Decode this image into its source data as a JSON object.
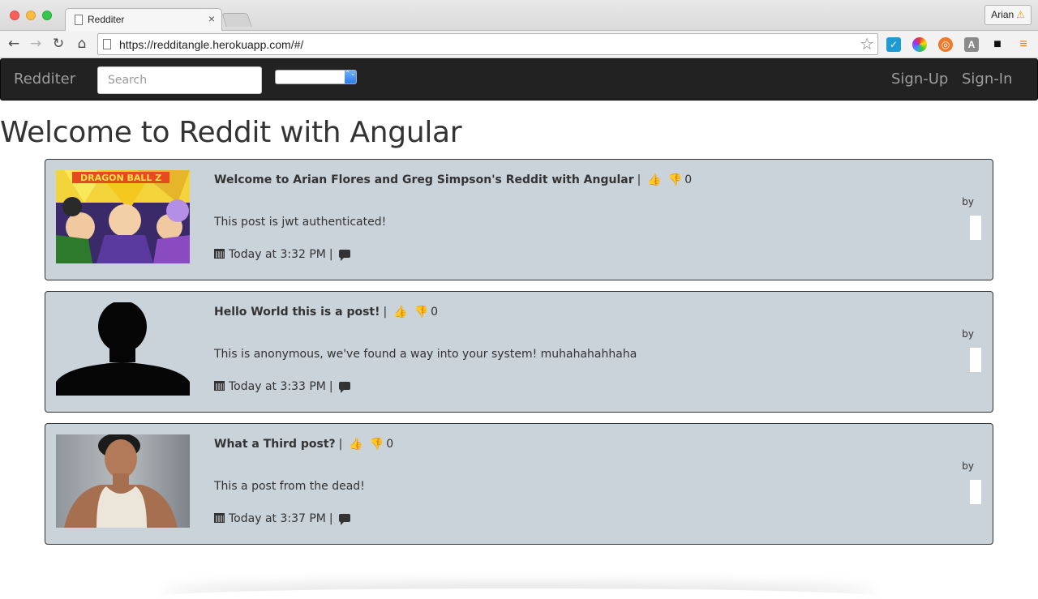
{
  "browser": {
    "tab_title": "Redditer",
    "tab_close": "×",
    "profile_name": "Arian",
    "profile_warning": "⚠",
    "url_prefix": "https://",
    "url_host": "redditangle.herokuapp.com",
    "url_path": "/#/",
    "nav_icons": [
      "back-arrow-icon",
      "forward-arrow-icon",
      "reload-icon",
      "home-icon"
    ],
    "extensions": [
      {
        "name": "checkmark-extension-icon",
        "glyph": "✓"
      },
      {
        "name": "color-wheel-extension-icon",
        "glyph": ""
      },
      {
        "name": "lifebuoy-extension-icon",
        "glyph": "◎"
      },
      {
        "name": "font-extension-icon",
        "glyph": "A"
      },
      {
        "name": "camera-extension-icon",
        "glyph": "■"
      },
      {
        "name": "menu-icon",
        "glyph": "≡"
      }
    ]
  },
  "navbar": {
    "brand": "Redditer",
    "search_placeholder": "Search",
    "select_value": "",
    "signup": "Sign-Up",
    "signin": "Sign-In"
  },
  "page": {
    "title": "Welcome to Reddit with Angular"
  },
  "posts": [
    {
      "title": "Welcome to Arian Flores and Greg Simpson's Reddit with Angular",
      "score": "0",
      "body": "This post is jwt authenticated!",
      "time": "Today at 3:32 PM",
      "by": "by",
      "thumbnail": "dragon-ball-z-image"
    },
    {
      "title": "Hello World this is a post!",
      "score": "0",
      "body": "This is anonymous, we've found a way into your system! muhahahahhaha",
      "time": "Today at 3:33 PM",
      "by": "by",
      "thumbnail": "silhouette-image"
    },
    {
      "title": "What a Third post?",
      "score": "0",
      "body": "This a post from the dead!",
      "time": "Today at 3:37 PM",
      "by": "by",
      "thumbnail": "person-photo-image"
    }
  ],
  "glyphs": {
    "separator": "|",
    "thumbs_up": "👍",
    "thumbs_down": "👎",
    "star": "☆",
    "back": "←",
    "forward": "→",
    "reload": "↻",
    "home": "⌂",
    "select_arrows": "⌃⌄"
  },
  "colors": {
    "navbar_bg": "#222222",
    "navbar_text": "#9d9d9d",
    "post_bg": "#cad2da",
    "upvote": "#2c9a2c",
    "downvote": "#d62020"
  }
}
